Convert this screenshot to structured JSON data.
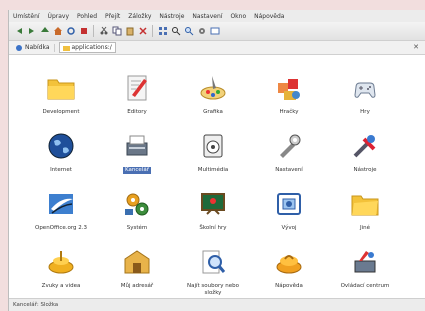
{
  "menu": [
    "Umístění",
    "Úpravy",
    "Pohled",
    "Přejít",
    "Záložky",
    "Nástroje",
    "Nastavení",
    "Okno",
    "Nápověda"
  ],
  "toolbar_icons": [
    "back-icon",
    "forward-icon",
    "up-icon",
    "home-icon",
    "reload-icon",
    "stop-icon",
    "cut-icon",
    "copy-icon",
    "paste-icon",
    "delete-icon",
    "view-icon",
    "search-icon",
    "zoom-icon",
    "settings-icon",
    "window-icon"
  ],
  "locationbar": {
    "places_label": "Nabídka",
    "location_value": "applications:/"
  },
  "items": [
    {
      "label": "Development",
      "icon": "folder-icon"
    },
    {
      "label": "Editory",
      "icon": "editor-icon"
    },
    {
      "label": "Grafika",
      "icon": "graphics-icon"
    },
    {
      "label": "Hračky",
      "icon": "toys-icon"
    },
    {
      "label": "Hry",
      "icon": "games-icon"
    },
    {
      "label": "Internet",
      "icon": "internet-icon"
    },
    {
      "label": "Kancelář",
      "icon": "office-icon",
      "selected": true
    },
    {
      "label": "Multimédia",
      "icon": "multimedia-icon"
    },
    {
      "label": "Nastavení",
      "icon": "settings-tools-icon"
    },
    {
      "label": "Nástroje",
      "icon": "utilities-icon"
    },
    {
      "label": "OpenOffice.org 2.3",
      "icon": "openoffice-icon"
    },
    {
      "label": "Systém",
      "icon": "system-icon"
    },
    {
      "label": "Školní hry",
      "icon": "edu-icon"
    },
    {
      "label": "Vývoj",
      "icon": "development-icon"
    },
    {
      "label": "Jiné",
      "icon": "other-folder-icon"
    },
    {
      "label": "Zvuky a videa",
      "icon": "sound-video-icon"
    },
    {
      "label": "Můj adresář",
      "icon": "personal-icon"
    },
    {
      "label": "Najít soubory nebo složky",
      "icon": "find-files-icon"
    },
    {
      "label": "Nápověda",
      "icon": "help-icon"
    },
    {
      "label": "Ovládací centrum",
      "icon": "control-center-icon"
    }
  ],
  "status": "Kancelář: Složka"
}
